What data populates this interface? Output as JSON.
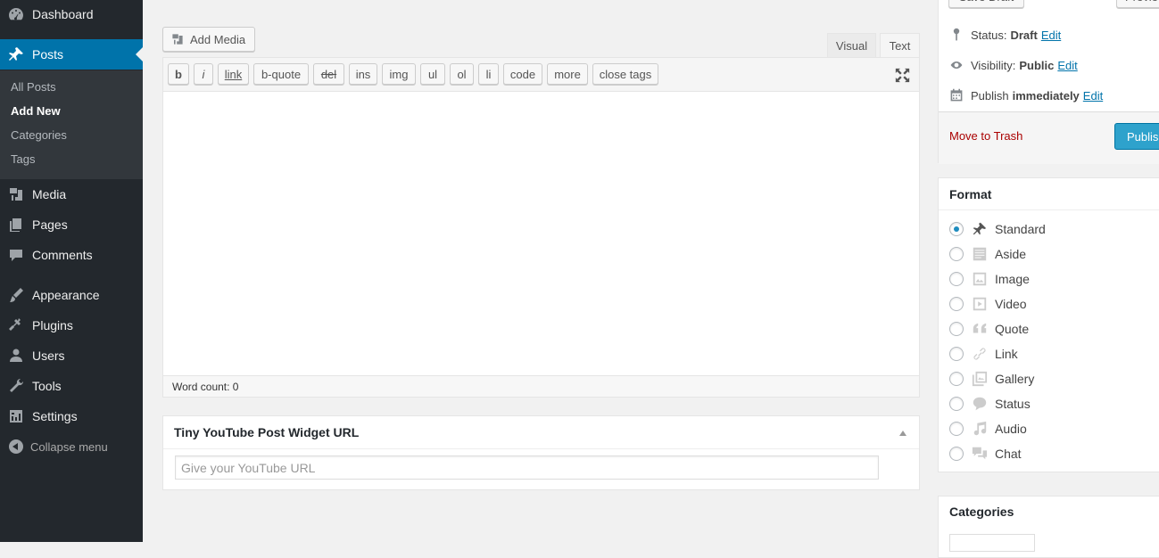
{
  "sidebar": {
    "menu": [
      {
        "label": "Dashboard",
        "icon": "dashboard-icon"
      },
      {
        "label": "Posts",
        "icon": "pin-icon"
      },
      {
        "label": "Media",
        "icon": "media-icon"
      },
      {
        "label": "Pages",
        "icon": "pages-icon"
      },
      {
        "label": "Comments",
        "icon": "comments-icon"
      },
      {
        "label": "Appearance",
        "icon": "appearance-icon"
      },
      {
        "label": "Plugins",
        "icon": "plugins-icon"
      },
      {
        "label": "Users",
        "icon": "users-icon"
      },
      {
        "label": "Tools",
        "icon": "tools-icon"
      },
      {
        "label": "Settings",
        "icon": "settings-icon"
      }
    ],
    "submenu": [
      "All Posts",
      "Add New",
      "Categories",
      "Tags"
    ],
    "collapse_label": "Collapse menu"
  },
  "editor": {
    "add_media": "Add Media",
    "tab_visual": "Visual",
    "tab_text": "Text",
    "quicktags": [
      "b",
      "i",
      "link",
      "b-quote",
      "del",
      "ins",
      "img",
      "ul",
      "ol",
      "li",
      "code",
      "more",
      "close tags"
    ],
    "word_count": "Word count: 0"
  },
  "youtube_widget": {
    "title": "Tiny YouTube Post Widget URL",
    "placeholder": "Give your YouTube URL"
  },
  "publish": {
    "save_draft": "Save Draft",
    "preview": "Previe",
    "status_label": "Status:",
    "status_value": "Draft",
    "visibility_label": "Visibility:",
    "visibility_value": "Public",
    "publish_label": "Publish",
    "publish_value": "immediately",
    "edit": "Edit",
    "trash": "Move to Trash",
    "publish_button": "Publis"
  },
  "format": {
    "title": "Format",
    "options": [
      "Standard",
      "Aside",
      "Image",
      "Video",
      "Quote",
      "Link",
      "Gallery",
      "Status",
      "Audio",
      "Chat"
    ],
    "selected": "Standard"
  },
  "categories": {
    "title": "Categories"
  },
  "colors": {
    "sidebar_bg": "#23282d",
    "accent": "#0073aa",
    "publish_button": "#2ea2cc",
    "trash": "#a00"
  }
}
